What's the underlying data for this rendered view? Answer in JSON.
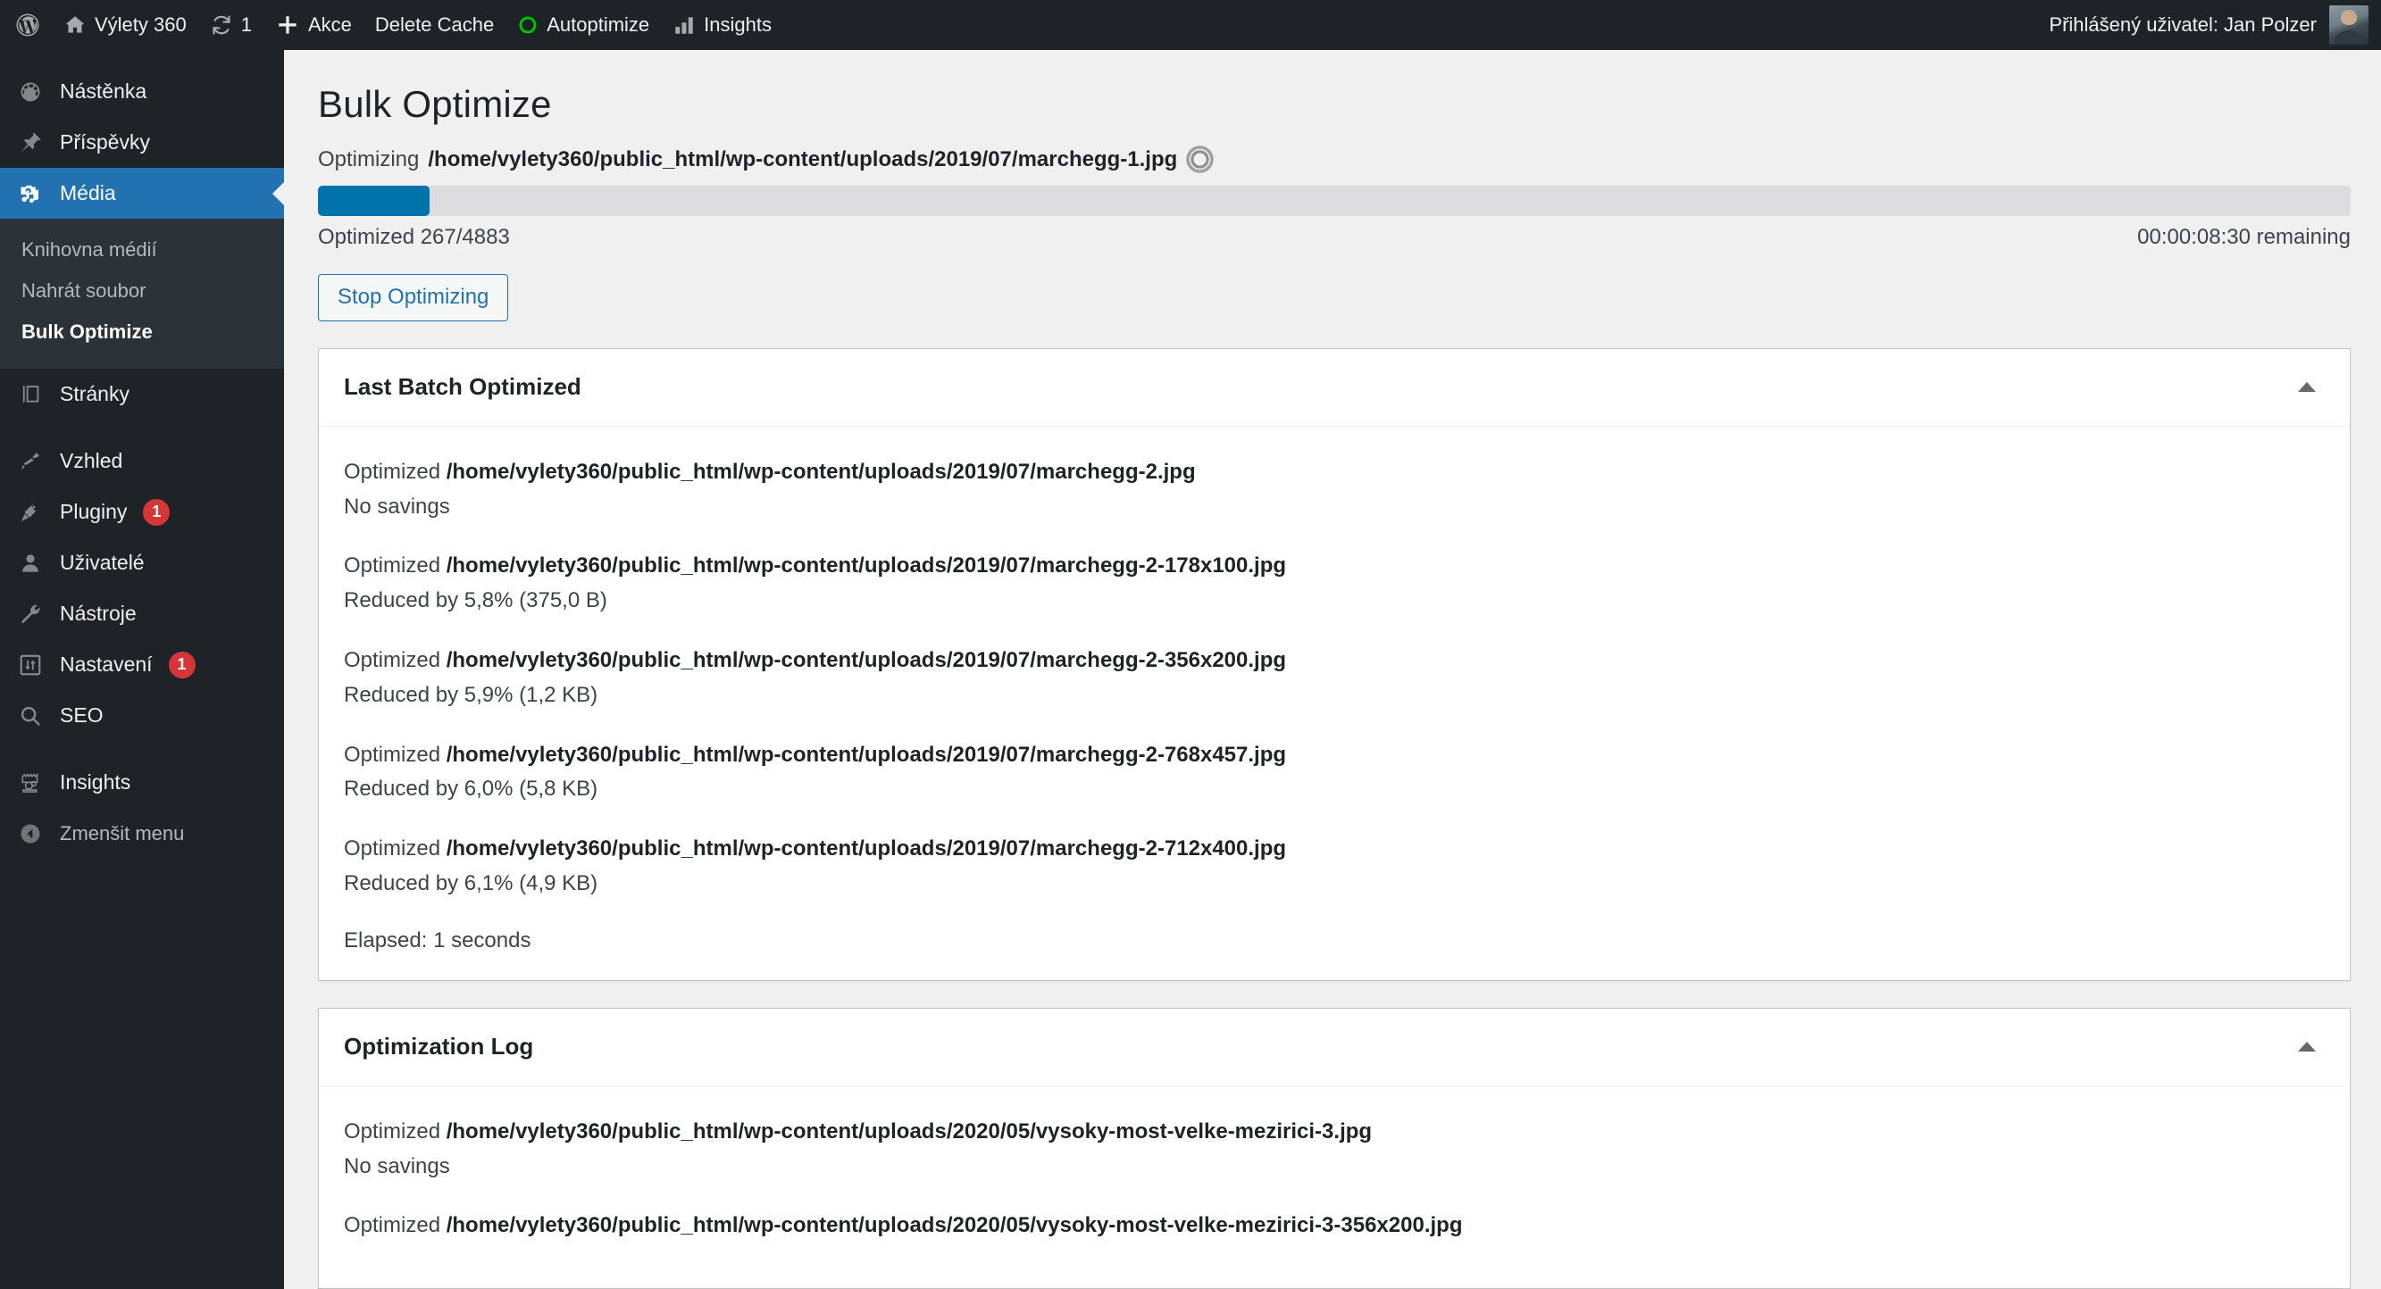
{
  "adminbar": {
    "items": [
      {
        "icon": "wordpress-logo-icon",
        "label": ""
      },
      {
        "icon": "home-icon",
        "label": "Výlety 360"
      },
      {
        "icon": "update-icon",
        "label": "1"
      },
      {
        "icon": "plus-icon",
        "label": "Akce"
      },
      {
        "icon": "none",
        "label": "Delete Cache"
      },
      {
        "icon": "autoptimize-circle-icon",
        "label": "Autoptimize"
      },
      {
        "icon": "bar-chart-icon",
        "label": "Insights"
      }
    ],
    "account": {
      "label": "Přihlášený uživatel: Jan Polzer",
      "avatar": "user-avatar"
    }
  },
  "sidebar": {
    "items": [
      {
        "label": "Nástěnka",
        "icon": "dashboard-icon",
        "badge": ""
      },
      {
        "label": "Příspěvky",
        "icon": "pin-icon",
        "badge": ""
      },
      {
        "label": "Média",
        "icon": "media-icon",
        "badge": "",
        "current": true
      },
      {
        "label": "Stránky",
        "icon": "pages-icon",
        "badge": ""
      },
      {
        "label": "Vzhled",
        "icon": "appearance-brush-icon",
        "badge": ""
      },
      {
        "label": "Pluginy",
        "icon": "plugin-plug-icon",
        "badge": "1"
      },
      {
        "label": "Uživatelé",
        "icon": "users-icon",
        "badge": ""
      },
      {
        "label": "Nástroje",
        "icon": "tools-wrench-icon",
        "badge": ""
      },
      {
        "label": "Nastavení",
        "icon": "settings-sliders-icon",
        "badge": "1"
      },
      {
        "label": "SEO",
        "icon": "search-icon",
        "badge": ""
      },
      {
        "label": "Insights",
        "icon": "insights-icon",
        "badge": ""
      }
    ],
    "submenu": [
      {
        "label": "Knihovna médií",
        "current": false
      },
      {
        "label": "Nahrát soubor",
        "current": false
      },
      {
        "label": "Bulk Optimize",
        "current": true
      }
    ],
    "collapse": {
      "label": "Zmenšit menu",
      "icon": "collapse-arrow-icon"
    }
  },
  "main": {
    "page_title": "Bulk Optimize",
    "optimizing": {
      "prefix": "Optimizing",
      "path": "/home/vylety360/public_html/wp-content/uploads/2019/07/marchegg-1.jpg",
      "spinner": "loading-spinner-icon"
    },
    "progress": {
      "percent": 5.5,
      "accent": "#0073aa",
      "track": "#dcdcde",
      "status": "Optimized 267/4883",
      "remaining": "00:00:08:30 remaining",
      "done": 267,
      "total": 4883
    },
    "stop_button": "Stop Optimizing",
    "panels": [
      {
        "title": "Last Batch Optimized",
        "toggle": "collapse-caret-up-icon",
        "entries": [
          {
            "prefix": "Optimized",
            "path": "/home/vylety360/public_html/wp-content/uploads/2019/07/marchegg-2.jpg",
            "result": "No savings"
          },
          {
            "prefix": "Optimized",
            "path": "/home/vylety360/public_html/wp-content/uploads/2019/07/marchegg-2-178x100.jpg",
            "result": "Reduced by 5,8% (375,0 B)"
          },
          {
            "prefix": "Optimized",
            "path": "/home/vylety360/public_html/wp-content/uploads/2019/07/marchegg-2-356x200.jpg",
            "result": "Reduced by 5,9% (1,2 KB)"
          },
          {
            "prefix": "Optimized",
            "path": "/home/vylety360/public_html/wp-content/uploads/2019/07/marchegg-2-768x457.jpg",
            "result": "Reduced by 6,0% (5,8 KB)"
          },
          {
            "prefix": "Optimized",
            "path": "/home/vylety360/public_html/wp-content/uploads/2019/07/marchegg-2-712x400.jpg",
            "result": "Reduced by 6,1% (4,9 KB)"
          }
        ],
        "elapsed": "Elapsed: 1 seconds"
      },
      {
        "title": "Optimization Log",
        "toggle": "collapse-caret-up-icon",
        "entries": [
          {
            "prefix": "Optimized",
            "path": "/home/vylety360/public_html/wp-content/uploads/2020/05/vysoky-most-velke-mezirici-3.jpg",
            "result": "No savings"
          },
          {
            "prefix": "Optimized",
            "path": "/home/vylety360/public_html/wp-content/uploads/2020/05/vysoky-most-velke-mezirici-3-356x200.jpg",
            "result": ""
          }
        ],
        "elapsed": ""
      }
    ]
  }
}
